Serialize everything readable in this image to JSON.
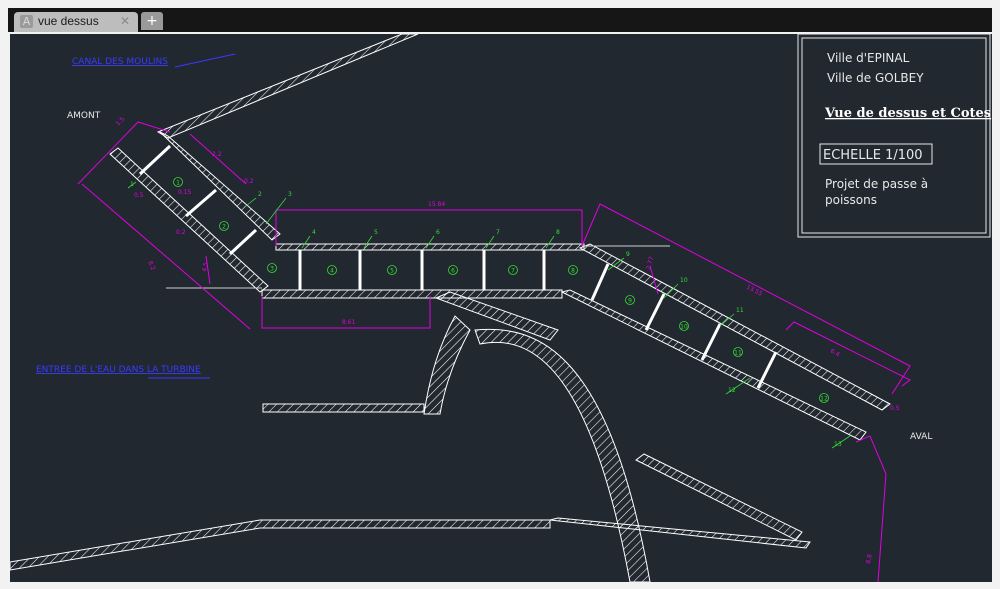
{
  "tab": {
    "title": "vue dessus",
    "logo_glyph": "A",
    "close_glyph": "✕",
    "new_tab_glyph": "+"
  },
  "title_block": {
    "line1": "Ville d'EPINAL",
    "line2": "Ville de GOLBEY",
    "heading": "Vue de dessus et Cotes",
    "scale": "ECHELLE 1/100",
    "project_line1": "Projet de passe à",
    "project_line2": "poissons"
  },
  "labels": {
    "canal": "CANAL DES MOULINS",
    "amont": "AMONT",
    "aval": "AVAL",
    "turbine": "ENTREE DE L'EAU DANS LA TURBINE"
  },
  "basins": [
    "1",
    "2",
    "3",
    "4",
    "5",
    "6",
    "7",
    "8",
    "9",
    "10",
    "11",
    "12"
  ],
  "callouts": [
    "1",
    "2",
    "3",
    "4",
    "5",
    "6",
    "7",
    "8",
    "9",
    "10",
    "11",
    "12",
    "13"
  ],
  "dimensions": [
    "1.5",
    "2.2",
    "0.2",
    "0.15",
    "0.5",
    "0.2",
    "4.5",
    "8.2",
    "15.84",
    "2.77",
    "13.55",
    "6.4",
    "8.61",
    "0.5",
    "8.8"
  ],
  "colors": {
    "background": "#212830",
    "structure": "#ffffff",
    "dimension": "#e000e0",
    "annotation": "#33dd33",
    "label_blue": "#3333ff"
  }
}
